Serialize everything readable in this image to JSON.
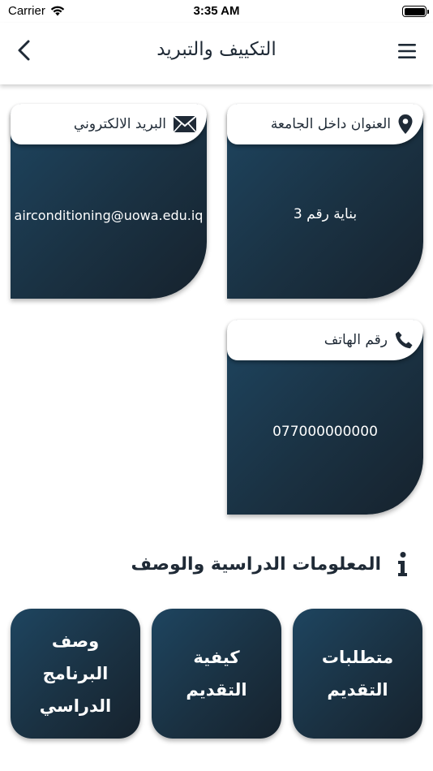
{
  "status_bar": {
    "carrier": "Carrier",
    "time": "3:35 AM"
  },
  "nav": {
    "title": "التكييف والتبريد"
  },
  "contacts": {
    "address": {
      "label": "العنوان داخل الجامعة",
      "value": "بناية رقم 3"
    },
    "email": {
      "label": "البريد الالكتروني",
      "value": "airconditioning@uowa.edu.iq"
    },
    "phone": {
      "label": "رقم الهاتف",
      "value": "077000000000"
    }
  },
  "section": {
    "title": "المعلومات الدراسية والوصف"
  },
  "tiles": {
    "requirements": "متطلبات التقديم",
    "how_to_apply_line1": "كيفية",
    "how_to_apply_line2": "التقديم",
    "program_desc_line1": "وصف البرنامج",
    "program_desc_line2": "الدراسي"
  },
  "colors": {
    "card_dark": "#1a3142",
    "card_light": "#1e4560",
    "text_dark": "#1f2a36"
  }
}
